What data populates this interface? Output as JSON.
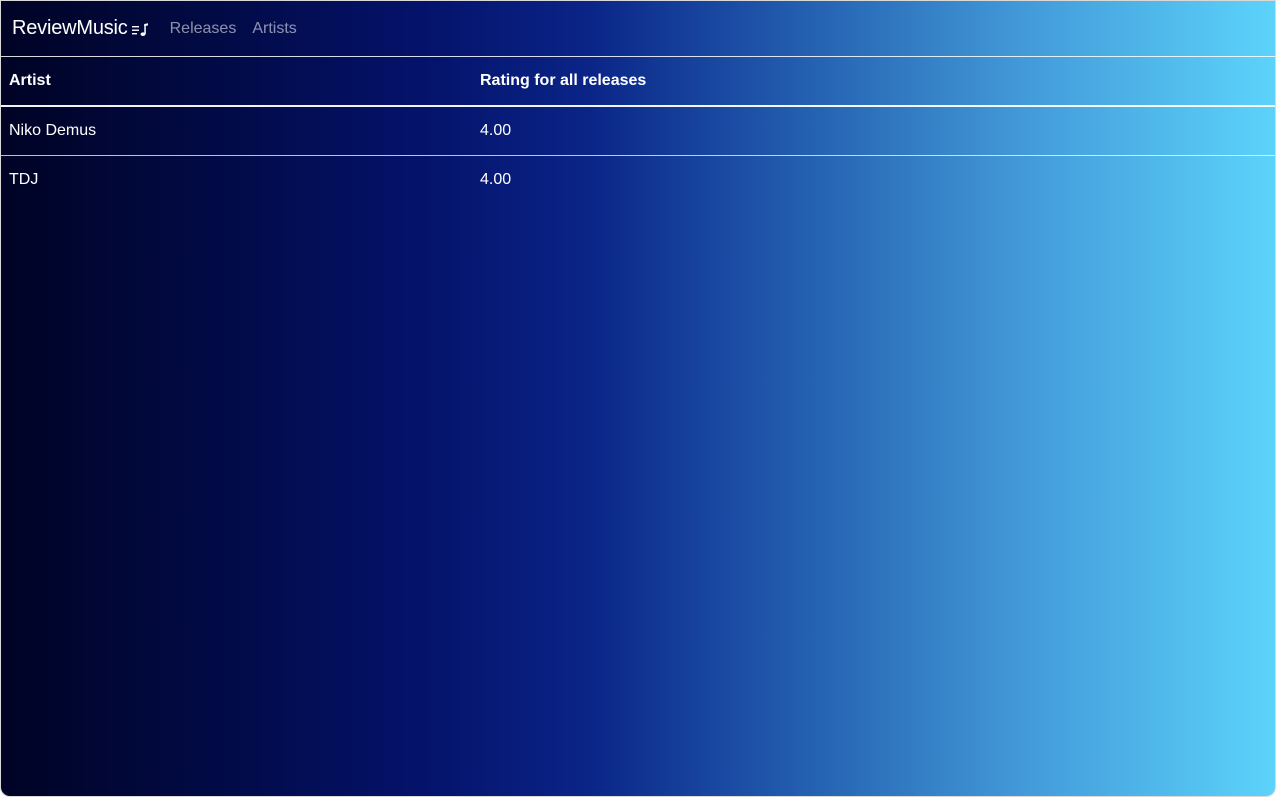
{
  "navbar": {
    "brand": "ReviewMusic",
    "brand_icon": "music-note-list-icon",
    "links": [
      {
        "label": "Releases"
      },
      {
        "label": "Artists"
      }
    ]
  },
  "table": {
    "headers": [
      "Artist",
      "Rating for all releases"
    ],
    "rows": [
      {
        "artist": "Niko Demus",
        "rating": "4.00"
      },
      {
        "artist": "TDJ",
        "rating": "4.00"
      }
    ]
  },
  "colors": {
    "gradient_start": "#000325",
    "gradient_end": "#5cd3fb",
    "text": "#ffffff",
    "nav_link": "rgba(255,255,255,0.55)"
  }
}
